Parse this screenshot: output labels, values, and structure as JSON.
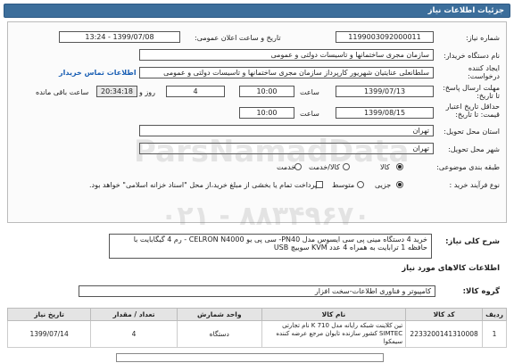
{
  "header": {
    "title": "جزئیات اطلاعات نیاز"
  },
  "form": {
    "need_number": {
      "label": "شماره نیاز:",
      "value": "1199003092000011"
    },
    "announce_datetime": {
      "label": "تاریخ و ساعت اعلان عمومی:",
      "value": "1399/07/08 - 13:24"
    },
    "buyer_org": {
      "label": "نام دستگاه خریدار:",
      "value": "سازمان مجری ساختمانها و تاسیسات دولتی و عمومی"
    },
    "creator": {
      "label": "ایجاد کننده درخواست:",
      "value": "سلطانعلی عنایتیان شهریور کارپرداز سازمان مجری ساختمانها و تاسیسات دولتی و عمومی",
      "contact_link": "اطلاعات تماس خریدار"
    },
    "reply_deadline": {
      "label": "مهلت ارسال پاسخ: تا تاریخ:",
      "date": "1399/07/13",
      "time_label": "ساعت",
      "time": "10:00",
      "days": "4",
      "days_label": "روز و",
      "remaining": "20:34:18",
      "remaining_label": "ساعت باقی مانده"
    },
    "price_validity": {
      "label": "حداقل تاریخ اعتبار قیمت: تا تاریخ:",
      "date": "1399/08/15",
      "time_label": "ساعت",
      "time": "10:00"
    },
    "delivery_province": {
      "label": "استان محل تحویل:",
      "value": "تهران"
    },
    "delivery_city": {
      "label": "شهر محل تحویل:",
      "value": "تهران"
    },
    "subject_class": {
      "label": "طبقه بندی موضوعی:",
      "options": [
        "کالا",
        "کالا/خدمت",
        "خدمت"
      ],
      "selected": "کالا"
    },
    "purchase_type": {
      "label": "نوع فرآیند خرید :",
      "options": [
        "جزیی",
        "متوسط"
      ],
      "selected": "جزیی",
      "note": "پرداخت تمام یا بخشی از مبلغ خرید،از محل \"اسناد خزانه اسلامی\" خواهد بود."
    }
  },
  "summary": {
    "label": "شرح کلی نیاز:",
    "text": "خرید 4 دستگاه مینی پی سی ایسوس مدل  PN40-  سی پی یو CELRON N4000 -  رم 4 گیگابایت با حافظه 1 ترابایت به همراه 4 عدد KVM سوییچ USB"
  },
  "goods_section": {
    "title": "اطلاعات کالاهای مورد نیاز",
    "group_label": "گروه کالا:",
    "group_value": "کامپیوتر و فناوری اطلاعات-سخت افزار",
    "columns": [
      "ردیف",
      "کد کالا",
      "نام کالا",
      "واحد شمارش",
      "تعداد / مقدار",
      "تاریخ نیاز"
    ],
    "rows": [
      {
        "row": "1",
        "code": "2233200141310008",
        "name": "تین کلاینت شبکه رایانه مدل K 710 نام تجارتی SIMTEC کشور سازنده تایوان مرجع عرضه کننده سیمکوا",
        "unit": "دستگاه",
        "qty": "4",
        "date": "1399/07/14"
      }
    ]
  },
  "watermark": {
    "brand": "ParsNamadData",
    "phone": "۰۲۱ - ۸۸۳۴۹۶۷۰"
  }
}
